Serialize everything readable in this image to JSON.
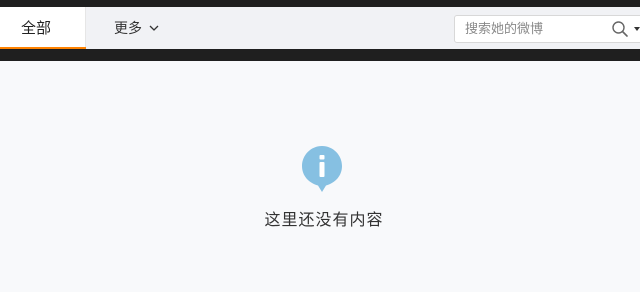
{
  "tabs": {
    "all_label": "全部",
    "more_label": "更多"
  },
  "search": {
    "placeholder": "搜索她的微博",
    "value": ""
  },
  "empty_state": {
    "message": "这里还没有内容"
  },
  "icons": {
    "more_dropdown": "chevron-down-icon",
    "search": "search-icon",
    "search_dropdown": "caret-down-icon",
    "empty_state": "info-icon"
  },
  "colors": {
    "active_tab_underline": "#ff8200",
    "info_icon": "#86c0e2",
    "dark_band": "#1f1f1f"
  }
}
